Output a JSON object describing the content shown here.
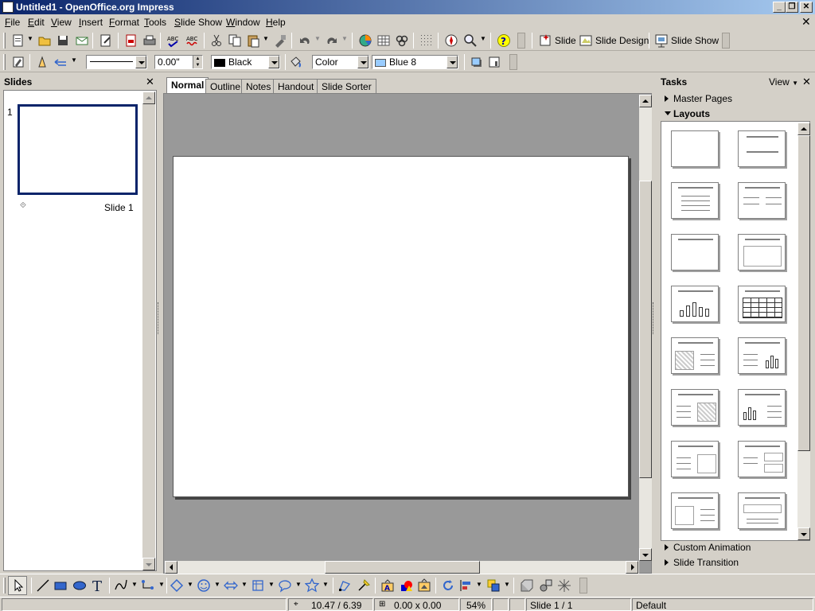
{
  "window": {
    "title": "Untitled1 - OpenOffice.org Impress"
  },
  "menu": [
    {
      "label": "File",
      "key": "F",
      "rest": "ile"
    },
    {
      "label": "Edit",
      "key": "E",
      "rest": "dit"
    },
    {
      "label": "View",
      "key": "V",
      "rest": "iew"
    },
    {
      "label": "Insert",
      "key": "I",
      "rest": "nsert"
    },
    {
      "label": "Format",
      "key": "F",
      "rest": "ormat"
    },
    {
      "label": "Tools",
      "key": "T",
      "rest": "ools"
    },
    {
      "label": "Slide Show",
      "key": "S",
      "rest": "lide Show"
    },
    {
      "label": "Window",
      "key": "W",
      "rest": "indow"
    },
    {
      "label": "Help",
      "key": "H",
      "rest": "elp"
    }
  ],
  "toolbar": {
    "slide_label": "Slide",
    "slide_design_label": "Slide Design",
    "slide_show_label": "Slide Show"
  },
  "line_toolbar": {
    "line_width": "0.00\"",
    "line_color": "Black",
    "area_style": "Color",
    "area_color": "Blue 8",
    "line_color_hex": "#000000",
    "area_color_hex": "#99ccff"
  },
  "slides_pane": {
    "title": "Slides",
    "slides": [
      {
        "number": "1",
        "name": "Slide 1"
      }
    ]
  },
  "view_tabs": [
    "Normal",
    "Outline",
    "Notes",
    "Handout",
    "Slide Sorter"
  ],
  "active_tab": "Normal",
  "tasks_pane": {
    "title": "Tasks",
    "view_label": "View",
    "sections": {
      "master_pages": "Master Pages",
      "layouts": "Layouts",
      "custom_animation": "Custom Animation",
      "slide_transition": "Slide Transition"
    }
  },
  "status": {
    "position": "10.47 / 6.39",
    "size": "0.00 x 0.00",
    "zoom": "54%",
    "slide": "Slide 1 / 1",
    "master": "Default"
  }
}
